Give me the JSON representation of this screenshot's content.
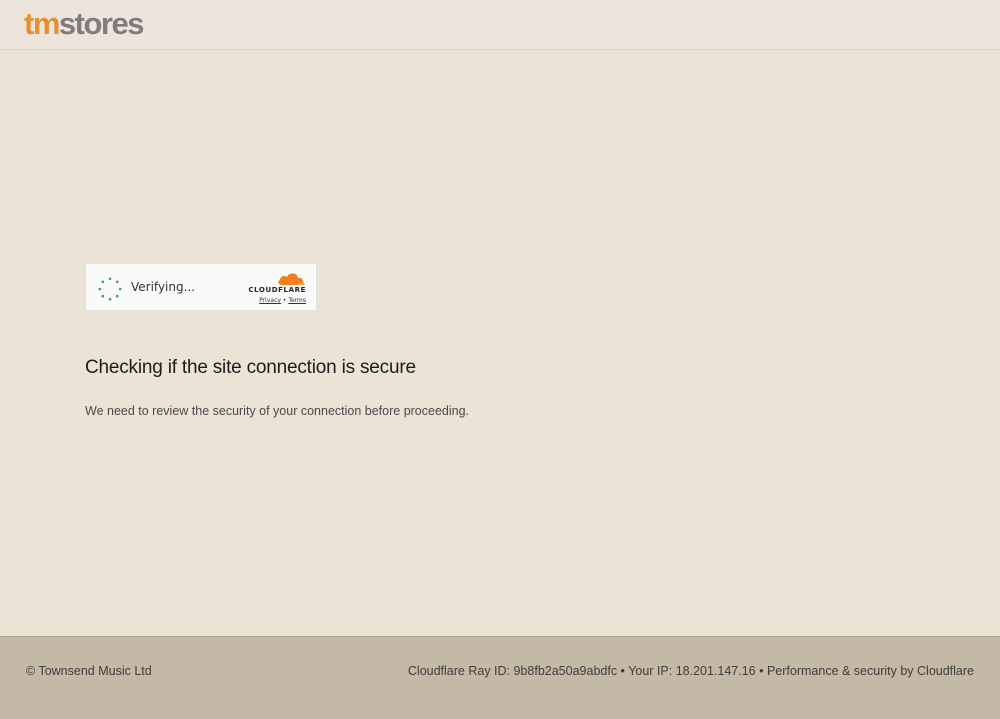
{
  "header": {
    "logo_tm": "tm",
    "logo_stores": "stores"
  },
  "widget": {
    "status": "Verifying...",
    "brand": "CLOUDFLARE",
    "privacy_label": "Privacy",
    "separator": "•",
    "terms_label": "Terms"
  },
  "main": {
    "heading": "Checking if the site connection is secure",
    "subtext": "We need to review the security of your connection before proceeding."
  },
  "footer": {
    "copyright": "© Townsend Music Ltd",
    "ray_label": "Cloudflare Ray ID: ",
    "ray_id": "9b8fb2a50a9abdfc",
    "sep1": " • ",
    "ip_label": "Your IP: ",
    "ip": "18.201.147.16",
    "sep2": " • ",
    "security_label": "Performance & security by Cloudflare"
  },
  "colors": {
    "background": "#ebe3d6",
    "footer": "#c4b8a7",
    "logo_accent": "#e58f2e",
    "logo_grey": "#7d7d7d",
    "spinner": "#2fa35f",
    "cloudflare_orange": "#f38020"
  },
  "icons": {
    "spinner": "loading-spinner-icon",
    "cloud": "cloudflare-cloud-icon"
  }
}
